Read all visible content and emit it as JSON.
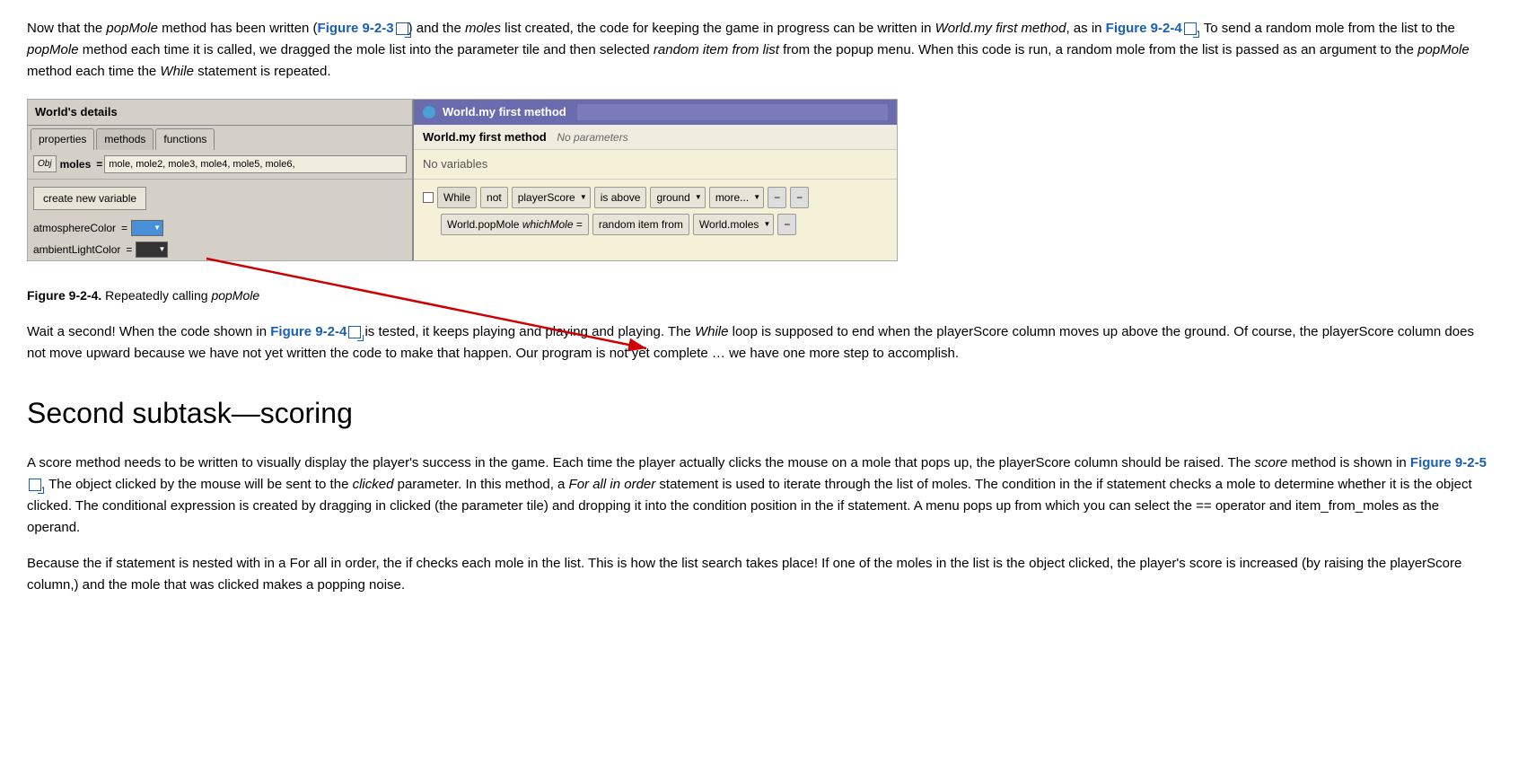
{
  "intro": {
    "text1": "Now that the ",
    "popMole1": "popMole",
    "text2": " method has been written (",
    "link1": "Figure 9-2-3",
    "text3": ") and the ",
    "moles1": "moles",
    "text4": " list created, the code for keeping the game in progress can be written in ",
    "worldMethod": "World.my first method",
    "text5": ", as in ",
    "link2": "Figure 9-2-4",
    "text6": ". To send a random mole from the list to the ",
    "popMole2": "popMole",
    "text7": " method each time it is called, we dragged the mole list into the parameter tile and then selected ",
    "randomItem": "random item from list",
    "text8": " from the popup menu. When this code is run, a random mole from the list is passed as an argument to the ",
    "popMole3": "popMole",
    "text9": " method each time the ",
    "while1": "While",
    "text10": " statement is repeated."
  },
  "worldDetails": {
    "title": "World's details",
    "tabs": [
      "properties",
      "methods",
      "functions"
    ],
    "activeTab": "methods",
    "objBadge": "Obj",
    "molesLabel": "moles",
    "molesValue": "mole, mole2, mole3, mole4, mole5, mole6,",
    "createVarBtn": "create new variable",
    "variables": [
      {
        "name": "atmosphereColor",
        "colorClass": "blue"
      },
      {
        "name": "ambientLightColor",
        "colorClass": "dark"
      }
    ]
  },
  "methodPanel": {
    "title": "World.my first method",
    "circleColor": "#4a9fd4",
    "headerBg": "#6b6bb0",
    "subtitle": "World.my first method",
    "noParams": "No parameters",
    "noVars": "No variables",
    "whileBlock": {
      "checkbox": "",
      "keyword": "While",
      "not": "not",
      "playerScore": "playerScore",
      "isAbove": "is above",
      "ground": "ground",
      "more": "more...",
      "minus1": "−",
      "minus2": "−"
    },
    "popMoleRow": {
      "worldPopMole": "World.popMole",
      "whichMole": "whichMole",
      "equals": "=",
      "randomItemFrom": "random item from",
      "worldMoles": "World.moles",
      "minus": "−"
    }
  },
  "figureCaption": {
    "label": "Figure 9-2-4.",
    "text": " Repeatedly calling ",
    "method": "popMole"
  },
  "bodyText1": "Wait a second! When the code shown in ",
  "bodyLink1": "Figure 9-2-4",
  "bodyText2": " is tested, it keeps playing and playing and playing. The ",
  "whileItalic": "While",
  "bodyText3": " loop is supposed to end when the playerScore column moves up above the ground. Of course, the playerScore column does not move upward because we have not yet written the code to make that happen. Our program is not yet complete … we have one more step to accomplish.",
  "sectionHeading": "Second subtask—scoring",
  "para2text1": "A score method needs to be written to visually display the player's success in the game. Each time the player actually clicks the mouse on a mole that pops up, the playerScore column should be raised. The ",
  "scoreItalic": "score",
  "para2text2": " method is shown in ",
  "para2link": "Figure 9-2-5",
  "para2text3": ". The object clicked by the mouse will be sent to the ",
  "clickedItalic": "clicked",
  "para2text4": " parameter. In this method, a ",
  "forAllItalic": "For all in order",
  "para2text5": " statement is used to iterate through the list of moles. The condition in the if statement checks a mole to determine whether it is the object clicked. The conditional expression is created by dragging in clicked (the parameter tile) and dropping it into the condition position in the if statement. A menu pops up from which you can select the == operator and item_from_moles as the operand.",
  "para3text": "Because the if statement is nested with in a For all in order, the if checks each mole in the list. This is how the list search takes place! If one of the moles in the list is the object clicked, the player's score is increased (by raising the playerScore column,) and the mole that was clicked makes a popping noise."
}
